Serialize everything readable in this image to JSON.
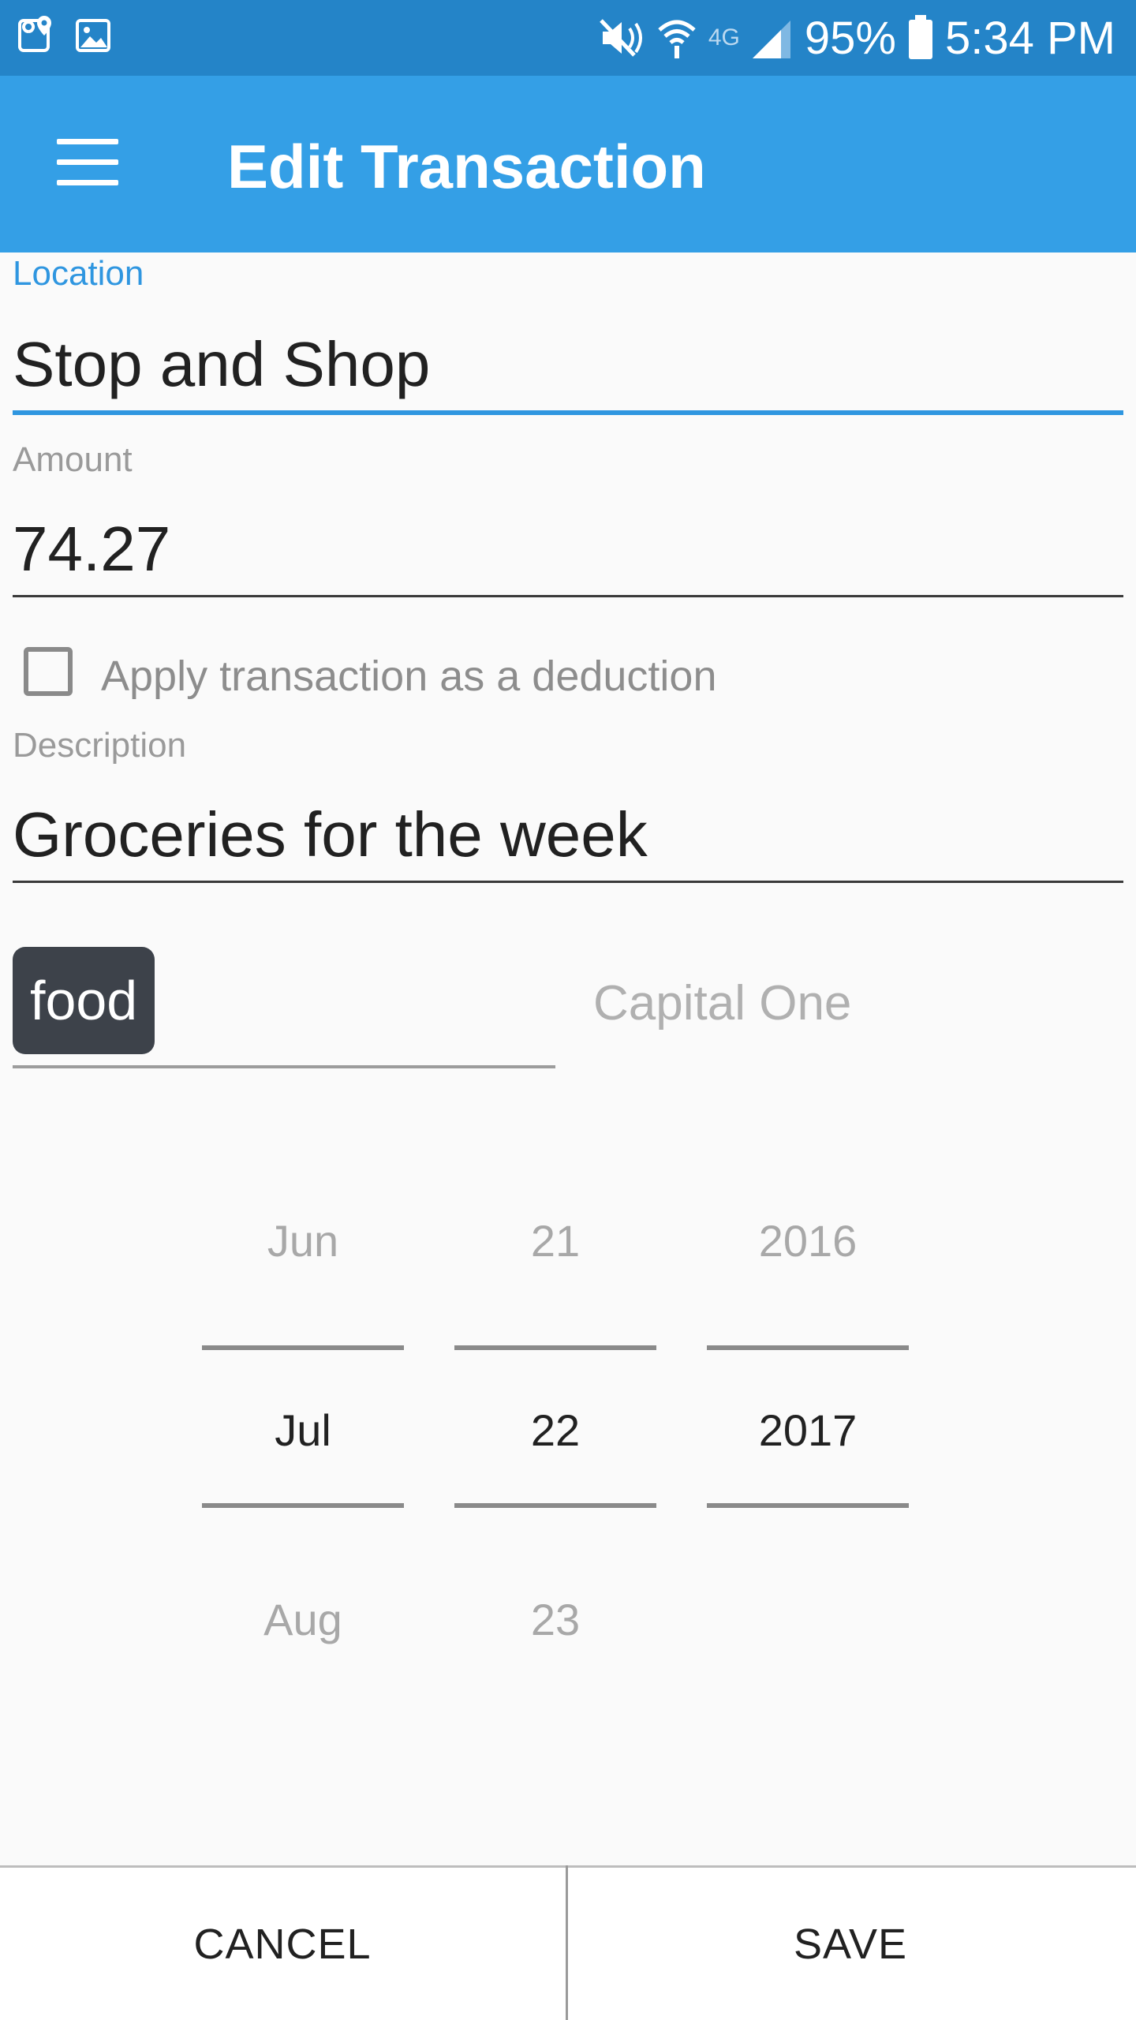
{
  "status_bar": {
    "battery_percent": "95%",
    "time": "5:34 PM",
    "icons": [
      "maps-icon",
      "gallery-icon",
      "mute-icon",
      "wifi-icon",
      "lte-icon",
      "signal-icon",
      "battery-icon"
    ],
    "lte_label": "4G"
  },
  "app_bar": {
    "title": "Edit Transaction",
    "background": "#349fe6",
    "status_bar_background": "#2484c8"
  },
  "form": {
    "location": {
      "label": "Location",
      "value": "Stop and Shop"
    },
    "amount": {
      "label": "Amount",
      "value": "74.27"
    },
    "deduction": {
      "label": "Apply transaction as a deduction",
      "checked": false
    },
    "description": {
      "label": "Description",
      "value": "Groceries for the week"
    },
    "tag": "food",
    "account": "Capital One"
  },
  "date_picker": {
    "month": {
      "prev": "Jun",
      "selected": "Jul",
      "next": "Aug"
    },
    "day": {
      "prev": "21",
      "selected": "22",
      "next": "23"
    },
    "year": {
      "prev": "2016",
      "selected": "2017",
      "next": ""
    }
  },
  "actions": {
    "cancel_label": "CANCEL",
    "save_label": "SAVE"
  },
  "colors": {
    "accent": "#2f96e0",
    "tag_background": "#3d424a"
  }
}
